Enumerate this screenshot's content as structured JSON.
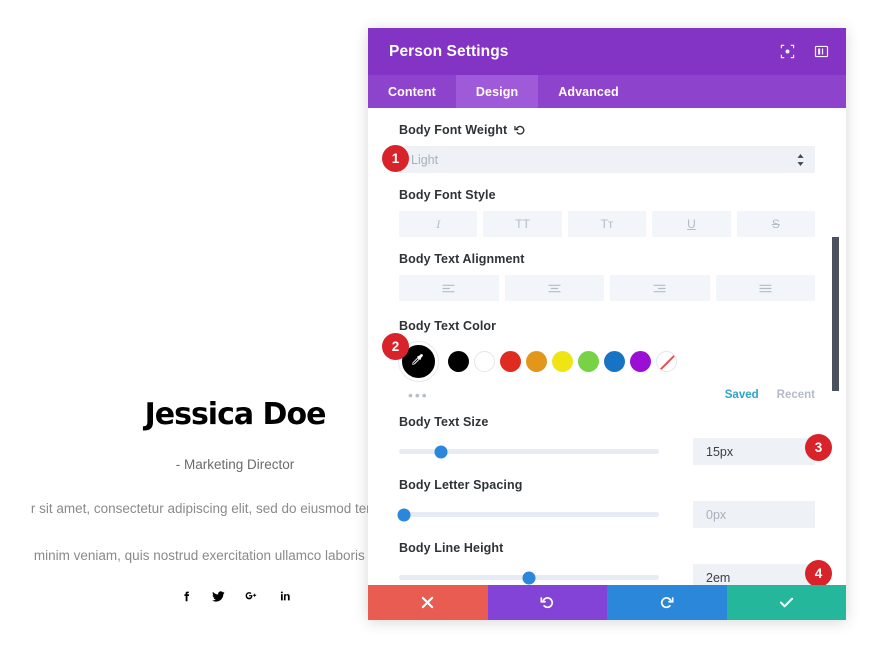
{
  "background": {
    "person": {
      "name": "Jessica Doe",
      "role": "- Marketing Director",
      "description_line1": "r sit amet, consectetur adipiscing elit, sed do eiusmod tempor incidid",
      "description_line2": "minim veniam, quis nostrud exercitation ullamco laboris nisi ut aliqu",
      "social": [
        {
          "name": "facebook-icon",
          "label": "f"
        },
        {
          "name": "twitter-icon",
          "label": "t"
        },
        {
          "name": "google-plus-icon",
          "label": "G+"
        },
        {
          "name": "linkedin-icon",
          "label": "in"
        }
      ]
    }
  },
  "modal": {
    "title": "Person Settings",
    "header_icons": [
      {
        "name": "focus-icon"
      },
      {
        "name": "layout-panel-icon"
      }
    ],
    "tabs": [
      {
        "label": "Content",
        "active": false
      },
      {
        "label": "Design",
        "active": true
      },
      {
        "label": "Advanced",
        "active": false
      }
    ],
    "fields": {
      "font_weight": {
        "label": "Body Font Weight",
        "reset_icon": "reset-icon",
        "value": "Light",
        "badge": "1"
      },
      "font_style": {
        "label": "Body Font Style",
        "buttons": [
          {
            "name": "italic-button",
            "label": "I"
          },
          {
            "name": "uppercase-button",
            "label": "TT"
          },
          {
            "name": "small-caps-button",
            "label": "Tᴛ"
          },
          {
            "name": "underline-button",
            "label": "U"
          },
          {
            "name": "strikethrough-button",
            "label": "S"
          }
        ]
      },
      "text_alignment": {
        "label": "Body Text Alignment",
        "buttons": [
          {
            "name": "align-left-button"
          },
          {
            "name": "align-center-button"
          },
          {
            "name": "align-right-button"
          },
          {
            "name": "align-justify-button"
          }
        ]
      },
      "text_color": {
        "label": "Body Text Color",
        "badge": "2",
        "eyedropper": {
          "name": "eyedropper-button",
          "color": "#000000"
        },
        "swatches": [
          {
            "name": "swatch-black",
            "color": "#000000"
          },
          {
            "name": "swatch-white",
            "color": "#ffffff"
          },
          {
            "name": "swatch-red",
            "color": "#e02b20"
          },
          {
            "name": "swatch-orange",
            "color": "#e2971b"
          },
          {
            "name": "swatch-yellow",
            "color": "#efe514"
          },
          {
            "name": "swatch-green",
            "color": "#77d245"
          },
          {
            "name": "swatch-blue",
            "color": "#1773c4"
          },
          {
            "name": "swatch-purple",
            "color": "#9b0ed6"
          },
          {
            "name": "swatch-none",
            "color": "transparent"
          }
        ],
        "more_dots": "•••",
        "saved_label": "Saved",
        "recent_label": "Recent"
      },
      "text_size": {
        "label": "Body Text Size",
        "value": "15px",
        "slider_percent": 16,
        "badge": "3"
      },
      "letter_spacing": {
        "label": "Body Letter Spacing",
        "value": "0px",
        "slider_percent": 2
      },
      "line_height": {
        "label": "Body Line Height",
        "value": "2em",
        "slider_percent": 50,
        "badge": "4"
      }
    },
    "footer_buttons": [
      {
        "name": "cancel-button",
        "icon": "close-icon"
      },
      {
        "name": "undo-button",
        "icon": "undo-icon"
      },
      {
        "name": "redo-button",
        "icon": "redo-icon"
      },
      {
        "name": "save-button",
        "icon": "check-icon"
      }
    ]
  },
  "colors": {
    "header": "#8434c4",
    "tabs": "#8e43cd",
    "tab_active": "#9f5ada",
    "badge": "#d8232a",
    "slider_thumb": "#2b87da",
    "saved_link": "#2ea3c6"
  }
}
